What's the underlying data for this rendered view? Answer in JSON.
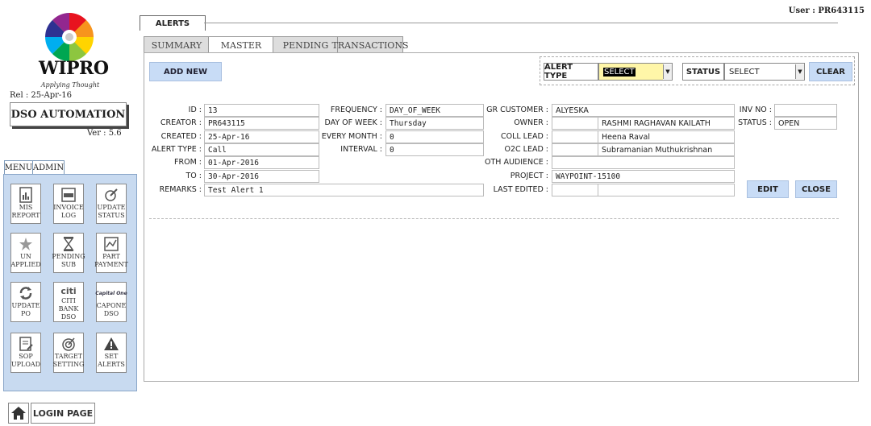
{
  "brand": {
    "name": "WIPRO",
    "tagline": "Applying Thought"
  },
  "app": {
    "release": "Rel : 25-Apr-16",
    "name": "DSO AUTOMATION",
    "version": "Ver : 5.6"
  },
  "user": {
    "label": "User : PR643115"
  },
  "left_tabs": {
    "menu": "MENU",
    "admin": "ADMIN"
  },
  "menu_items": [
    {
      "l1": "MIS",
      "l2": "REPORT",
      "icon": "report-icon"
    },
    {
      "l1": "INVOICE",
      "l2": "LOG",
      "icon": "log-icon"
    },
    {
      "l1": "UPDATE",
      "l2": "STATUS",
      "icon": "pen-icon"
    },
    {
      "l1": "UN",
      "l2": "APPLIED",
      "icon": "star-icon"
    },
    {
      "l1": "PENDING",
      "l2": "SUB",
      "icon": "hourglass-icon"
    },
    {
      "l1": "PART",
      "l2": "PAYMENT",
      "icon": "chart-icon"
    },
    {
      "l1": "UPDATE",
      "l2": "PO",
      "icon": "refresh-icon"
    },
    {
      "l1": "CITI BANK",
      "l2": "DSO",
      "icon": "citi-logo"
    },
    {
      "l1": "CAPONE",
      "l2": "DSO",
      "icon": "capitalone-logo"
    },
    {
      "l1": "SOP",
      "l2": "UPLOAD",
      "icon": "upload-icon"
    },
    {
      "l1": "TARGET",
      "l2": "SETTING",
      "icon": "target-icon"
    },
    {
      "l1": "SET",
      "l2": "ALERTS",
      "icon": "warning-icon"
    }
  ],
  "logos": {
    "citi": "citi",
    "capone": "Capital One"
  },
  "login": {
    "label": "LOGIN PAGE"
  },
  "section": {
    "title": "ALERTS"
  },
  "tabs": {
    "summary": "SUMMARY",
    "master": "MASTER",
    "pending": "PENDING",
    "transactions": "TRANSACTIONS"
  },
  "toolbar": {
    "add_new": "ADD NEW",
    "clear": "CLEAR"
  },
  "filters": {
    "alert_type": {
      "label": "ALERT TYPE",
      "value": "SELECT"
    },
    "status": {
      "label": "STATUS",
      "value": "SELECT"
    }
  },
  "detail": {
    "labels": {
      "id": "ID :",
      "creator": "CREATOR :",
      "created": "CREATED :",
      "alert_type": "ALERT TYPE :",
      "from": "FROM :",
      "to": "TO :",
      "remarks": "REMARKS :",
      "frequency": "FREQUENCY :",
      "day_of_week": "DAY OF WEEK :",
      "every_month": "EVERY MONTH :",
      "interval": "INTERVAL :",
      "gr_customer": "GR CUSTOMER :",
      "owner": "OWNER :",
      "coll_lead": "COLL LEAD :",
      "o2c_lead": "O2C LEAD :",
      "oth_audience": "OTH AUDIENCE :",
      "project": "PROJECT :",
      "last_edited": "LAST EDITED :",
      "inv_no": "INV NO :",
      "status": "STATUS :"
    },
    "values": {
      "id": "13",
      "creator": "PR643115",
      "created": "25-Apr-16",
      "alert_type": "Call",
      "from": "01-Apr-2016",
      "to": "30-Apr-2016",
      "remarks": "Test Alert 1",
      "frequency": "DAY_OF_WEEK",
      "day_of_week": "Thursday",
      "every_month": "0",
      "interval": "0",
      "gr_customer": "ALYESKA",
      "owner": "RASHMI RAGHAVAN KAILATH",
      "coll_lead": "Heena Raval",
      "o2c_lead": "Subramanian Muthukrishnan",
      "oth_audience": "",
      "project": "WAYPOINT-15100",
      "last_edited": "",
      "inv_no": "",
      "status": "OPEN"
    }
  },
  "actions": {
    "edit": "EDIT",
    "close": "CLOSE"
  }
}
